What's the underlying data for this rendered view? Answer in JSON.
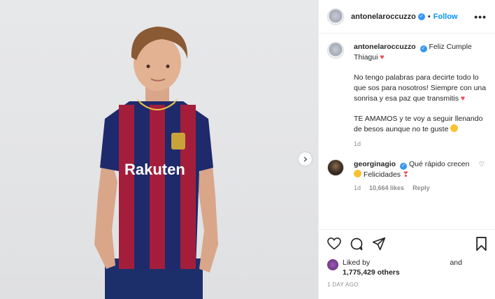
{
  "post": {
    "author": "antonelaroccuzzo",
    "follow_label": "Follow",
    "more_label": "•••",
    "separator": "•"
  },
  "caption": {
    "author": "antonelaroccuzzo",
    "line1": "Feliz Cumple Thiagui",
    "para2": "No tengo palabras para decirte todo lo que sos para nosotros! Siempre con una sonrisa y esa paz que transmitis",
    "para3": "TE AMAMOS y te voy a seguir llenando de besos aunque no te guste",
    "age": "1d"
  },
  "comment": {
    "author": "georginagio",
    "text_a": "Qué rápido crecen",
    "text_b": "Felicidades",
    "age": "1d",
    "likes": "10,664 likes",
    "reply_label": "Reply"
  },
  "likes": {
    "liked_by": "Liked by",
    "and": "and",
    "count": "1,775,429 others"
  },
  "timestamp": "1 DAY AGO",
  "colors": {
    "accent": "#0095f6",
    "heart": "#ed4956",
    "verified": "#3897f0"
  },
  "photo": {
    "shirt_text": "Rakuten"
  }
}
